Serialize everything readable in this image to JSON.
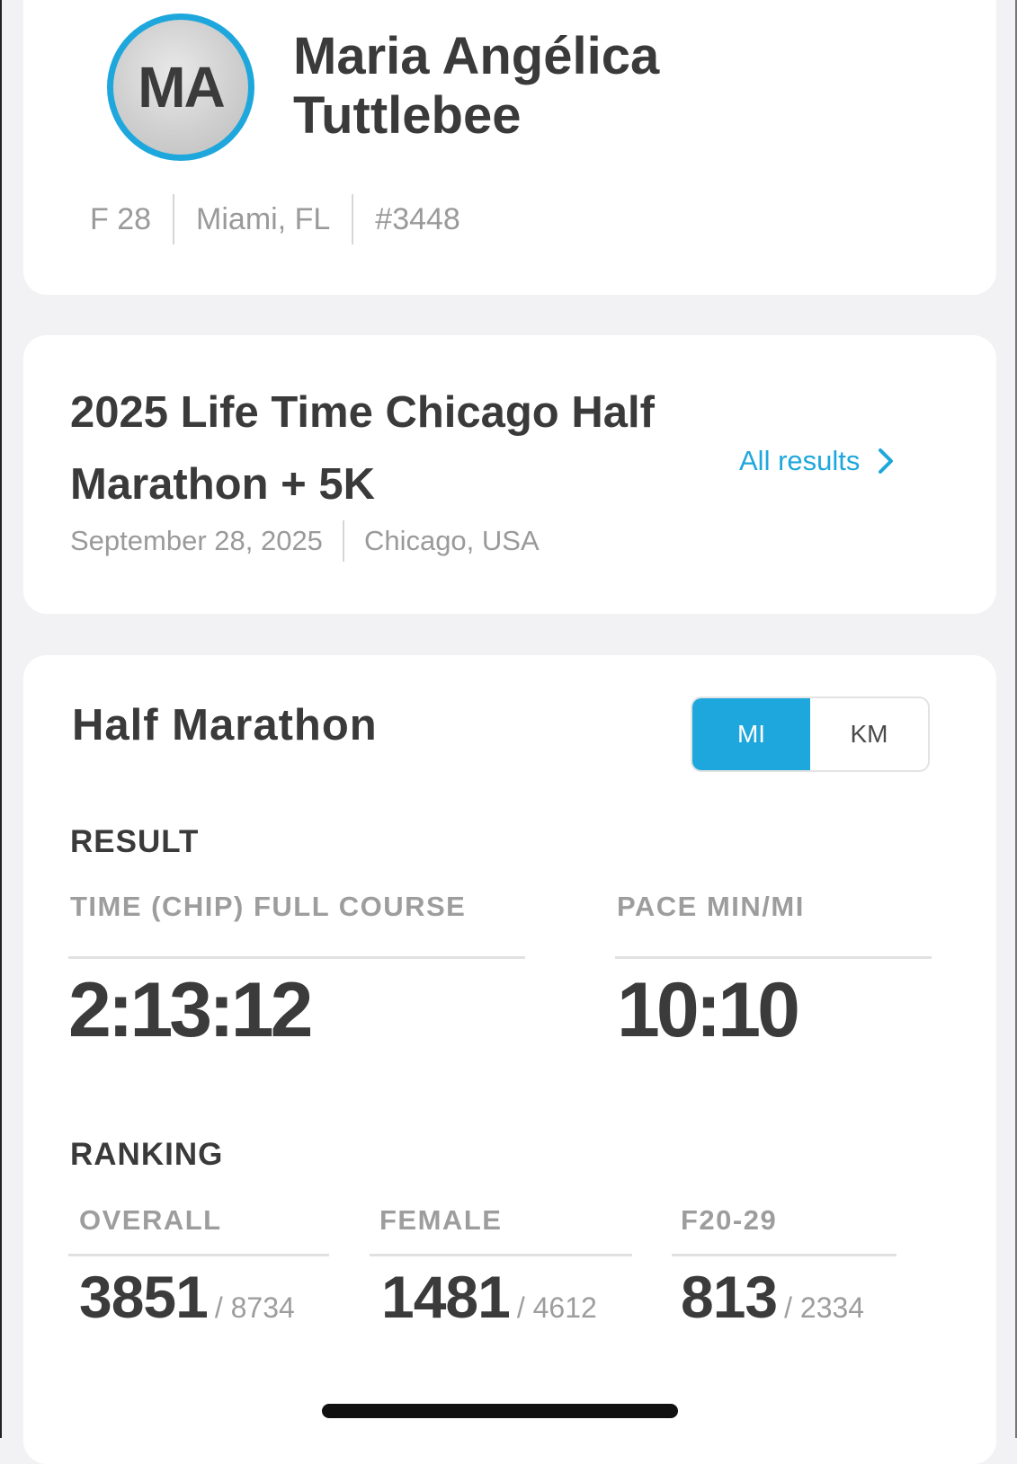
{
  "athlete": {
    "initials": "MA",
    "name": "Maria Angélica Tuttlebee",
    "gender_age": "F 28",
    "location": "Miami, FL",
    "bib": "#3448"
  },
  "event": {
    "title": "2025 Life Time Chicago Half Marathon + 5K",
    "date": "September 28, 2025",
    "location": "Chicago, USA",
    "all_results_label": "All results"
  },
  "race": {
    "name": "Half Marathon",
    "units": {
      "mi": "MI",
      "km": "KM",
      "selected": "MI"
    }
  },
  "result": {
    "heading": "RESULT",
    "time_label": "TIME (CHIP) FULL COURSE",
    "time_value": "2:13:12",
    "pace_label": "PACE MIN/MI",
    "pace_value": "10:10"
  },
  "ranking": {
    "heading": "RANKING",
    "items": [
      {
        "label": "OVERALL",
        "place": "3851",
        "total": "/ 8734"
      },
      {
        "label": "FEMALE",
        "place": "1481",
        "total": "/ 4612"
      },
      {
        "label": "F20-29",
        "place": "813",
        "total": "/ 2334"
      }
    ]
  },
  "colors": {
    "accent": "#1ea7dc",
    "text": "#3a3a3a",
    "muted": "#9a9a9a"
  }
}
